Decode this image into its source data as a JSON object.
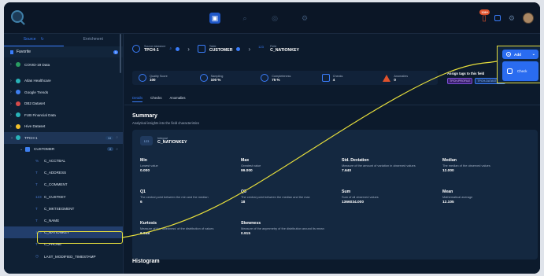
{
  "sidebar": {
    "tabs": [
      "Source",
      "Enrichment"
    ],
    "favorite": {
      "label": "Favorite",
      "count": "3"
    },
    "items": [
      {
        "label": "COVID-19 Data",
        "color": "#2a9d62"
      },
      {
        "label": "Atlas Healthcare",
        "color": "#29b3b9"
      },
      {
        "label": "Google Trends",
        "color": "#3e7ff0"
      },
      {
        "label": "DB2 Dataset",
        "color": "#d64a4a"
      },
      {
        "label": "FUB Financial Data",
        "color": "#29b3b9"
      },
      {
        "label": "Hive Dataset",
        "color": "#f0c02c"
      },
      {
        "label": "TPCH-1",
        "color": "#29b3b9",
        "count": "16"
      },
      {
        "label": "CUSTOMER",
        "color": "#3e7ff0",
        "count": "8"
      }
    ],
    "fields": [
      {
        "label": "C_ACCTBAL",
        "type": "%"
      },
      {
        "label": "C_ADDRESS",
        "type": "T"
      },
      {
        "label": "C_COMMENT",
        "type": "T"
      },
      {
        "label": "C_CUSTKEY",
        "type": "123"
      },
      {
        "label": "C_MKTSEGMENT",
        "type": "T"
      },
      {
        "label": "C_NAME",
        "type": "T"
      },
      {
        "label": "C_NATIONKEY",
        "type": "123"
      },
      {
        "label": "C_PHONE",
        "type": "T"
      },
      {
        "label": "LAST_MODIFIED_TIMESTAMP",
        "type": "clock"
      }
    ]
  },
  "breadcrumb": {
    "datastore_label": "Source datastore",
    "datastore": "TPCH-1",
    "table_label": "Table",
    "table": "CUSTOMER",
    "field_label": "Field",
    "field": "C_NATIONKEY"
  },
  "stats": [
    {
      "label": "Quality Score",
      "value": "100"
    },
    {
      "label": "Sampling",
      "value": "100 %"
    },
    {
      "label": "Completeness",
      "value": "75 %"
    },
    {
      "label": "Checks",
      "value": "4"
    },
    {
      "label": "Anomalies",
      "value": "0"
    }
  ],
  "tags": {
    "label": "Assign tags to this field",
    "items": [
      "TPCH-PROFILE",
      "TPCH-DATASTORE"
    ]
  },
  "main_tabs": [
    "Details",
    "Checks",
    "Anomalies"
  ],
  "summary": {
    "title": "Summary",
    "subtitle": "Analytical insights into the field characteristics"
  },
  "field_card": {
    "type": "Integral",
    "name": "C_NATIONKEY",
    "badge": "123"
  },
  "metrics": [
    {
      "name": "Min",
      "desc": "Lowest value",
      "value": "0.000"
    },
    {
      "name": "Max",
      "desc": "Greatest value",
      "value": "99.000"
    },
    {
      "name": "Std. Deviation",
      "desc": "Measure of the amount of variation in observed values",
      "value": "7.640"
    },
    {
      "name": "Median",
      "desc": "The median of the observed values",
      "value": "12.000"
    },
    {
      "name": "Q1",
      "desc": "The central point between the min and the median",
      "value": "6"
    },
    {
      "name": "Q3",
      "desc": "The central point between the median and the max",
      "value": "18"
    },
    {
      "name": "Sum",
      "desc": "Sum of all observed values",
      "value": "1366034.000"
    },
    {
      "name": "Mean",
      "desc": "Mathematical average",
      "value": "12.105"
    },
    {
      "name": "Kurtosis",
      "desc": "Measure of the 'tailedness' of the distribution of values",
      "value": "6.948"
    },
    {
      "name": "Skewness",
      "desc": "Measure of the asymmetry of the distribution around its mean",
      "value": "0.915"
    }
  ],
  "histogram_title": "Histogram",
  "add_menu": {
    "add_label": "Add",
    "check_label": "Check"
  },
  "notifications": {
    "count": "100+"
  },
  "colors": {
    "accent": "#2a6cf0",
    "highlight": "#e6de3c",
    "background": "#0c1a2c"
  }
}
